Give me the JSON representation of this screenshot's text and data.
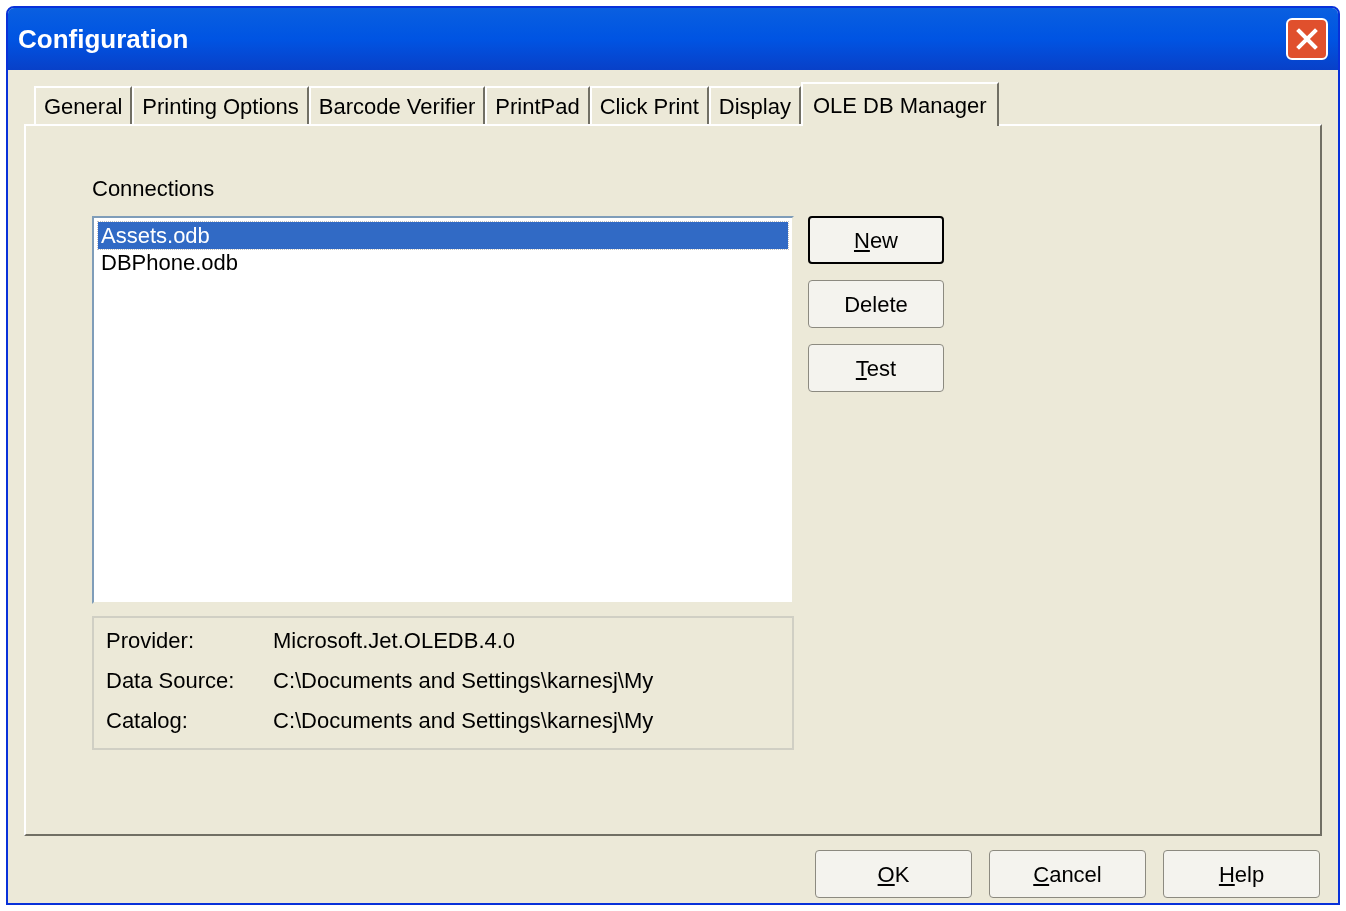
{
  "window": {
    "title": "Configuration"
  },
  "tabs": [
    {
      "label": "General",
      "selected": false
    },
    {
      "label": "Printing Options",
      "selected": false
    },
    {
      "label": "Barcode Verifier",
      "selected": false
    },
    {
      "label": "PrintPad",
      "selected": false
    },
    {
      "label": "Click Print",
      "selected": false
    },
    {
      "label": "Display",
      "selected": false
    },
    {
      "label": "OLE DB Manager",
      "selected": true
    }
  ],
  "connections": {
    "label": "Connections",
    "items": [
      {
        "label": "Assets.odb",
        "selected": true
      },
      {
        "label": "DBPhone.odb",
        "selected": false
      }
    ]
  },
  "side_buttons": [
    {
      "label": "New",
      "underline_first": true,
      "default": true
    },
    {
      "label": "Delete",
      "underline_first": false,
      "default": false
    },
    {
      "label": "Test",
      "underline_first": true,
      "default": false
    }
  ],
  "details": [
    {
      "label": "Provider:",
      "value": "Microsoft.Jet.OLEDB.4.0"
    },
    {
      "label": "Data Source:",
      "value": "C:\\Documents and Settings\\karnesj\\My"
    },
    {
      "label": "Catalog:",
      "value": "C:\\Documents and Settings\\karnesj\\My"
    }
  ],
  "footer_buttons": [
    {
      "label": "OK",
      "underline_first": true
    },
    {
      "label": "Cancel",
      "underline_first": true
    },
    {
      "label": "Help",
      "underline_first": true
    }
  ]
}
